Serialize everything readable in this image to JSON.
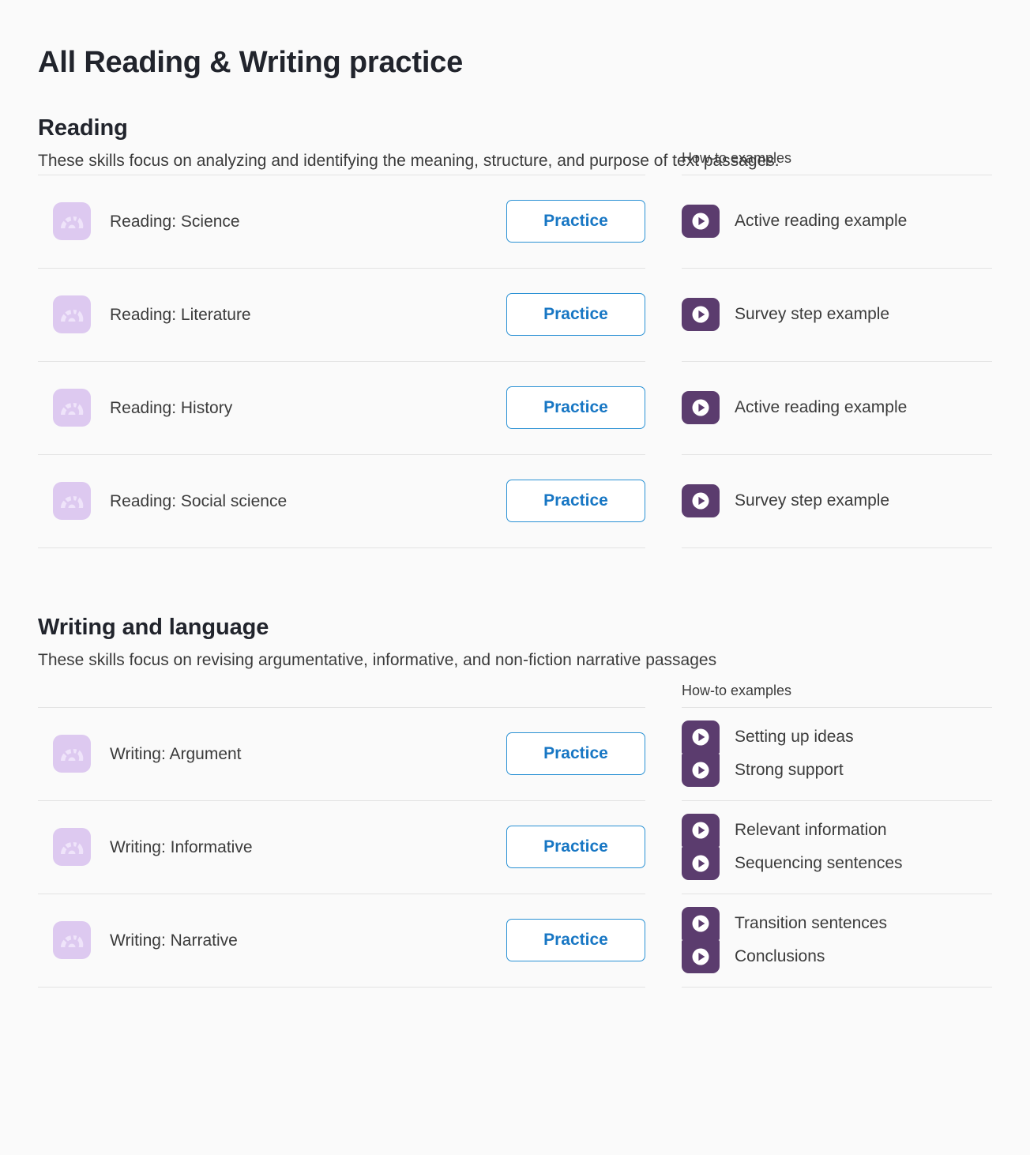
{
  "page": {
    "title": "All Reading & Writing practice"
  },
  "sections": [
    {
      "id": "reading",
      "title": "Reading",
      "description": "These skills focus on analyzing and identifying the meaning, structure, and purpose of text passages.",
      "howto_label": "How-to examples",
      "practice_label": "Practice",
      "rows": [
        {
          "skill": "Reading: Science",
          "skill_icon": "skill-gauge-icon",
          "practice_label": "Practice",
          "videos": [
            {
              "label": "Active reading example",
              "icon": "video-play-icon"
            }
          ]
        },
        {
          "skill": "Reading: Literature",
          "skill_icon": "skill-gauge-icon",
          "practice_label": "Practice",
          "videos": [
            {
              "label": "Survey step example",
              "icon": "video-play-icon"
            }
          ]
        },
        {
          "skill": "Reading: History",
          "skill_icon": "skill-gauge-icon",
          "practice_label": "Practice",
          "videos": [
            {
              "label": "Active reading example",
              "icon": "video-play-icon"
            }
          ]
        },
        {
          "skill": "Reading: Social science",
          "skill_icon": "skill-gauge-icon",
          "practice_label": "Practice",
          "videos": [
            {
              "label": "Survey step example",
              "icon": "video-play-icon"
            }
          ]
        }
      ]
    },
    {
      "id": "writing",
      "title": "Writing and language",
      "description": "These skills focus on revising argumentative, informative, and non-fiction narrative passages",
      "howto_label": "How-to examples",
      "practice_label": "Practice",
      "rows": [
        {
          "skill": "Writing: Argument",
          "skill_icon": "skill-gauge-icon",
          "practice_label": "Practice",
          "videos": [
            {
              "label": "Setting up ideas",
              "icon": "video-play-icon"
            },
            {
              "label": "Strong support",
              "icon": "video-play-icon"
            }
          ]
        },
        {
          "skill": "Writing: Informative",
          "skill_icon": "skill-gauge-icon",
          "practice_label": "Practice",
          "videos": [
            {
              "label": "Relevant information",
              "icon": "video-play-icon"
            },
            {
              "label": "Sequencing sentences",
              "icon": "video-play-icon"
            }
          ]
        },
        {
          "skill": "Writing: Narrative",
          "skill_icon": "skill-gauge-icon",
          "practice_label": "Practice",
          "videos": [
            {
              "label": "Transition sentences",
              "icon": "video-play-icon"
            },
            {
              "label": "Conclusions",
              "icon": "video-play-icon"
            }
          ]
        }
      ]
    }
  ],
  "colors": {
    "background": "#fafafa",
    "heading": "#21242c",
    "body_text": "#3b3b3b",
    "practice_border": "#2a91d4",
    "practice_text": "#1877c4",
    "skill_icon_bg": "#ddc9f0",
    "video_icon_bg": "#5b3c6e",
    "divider": "#e3e3e3"
  }
}
